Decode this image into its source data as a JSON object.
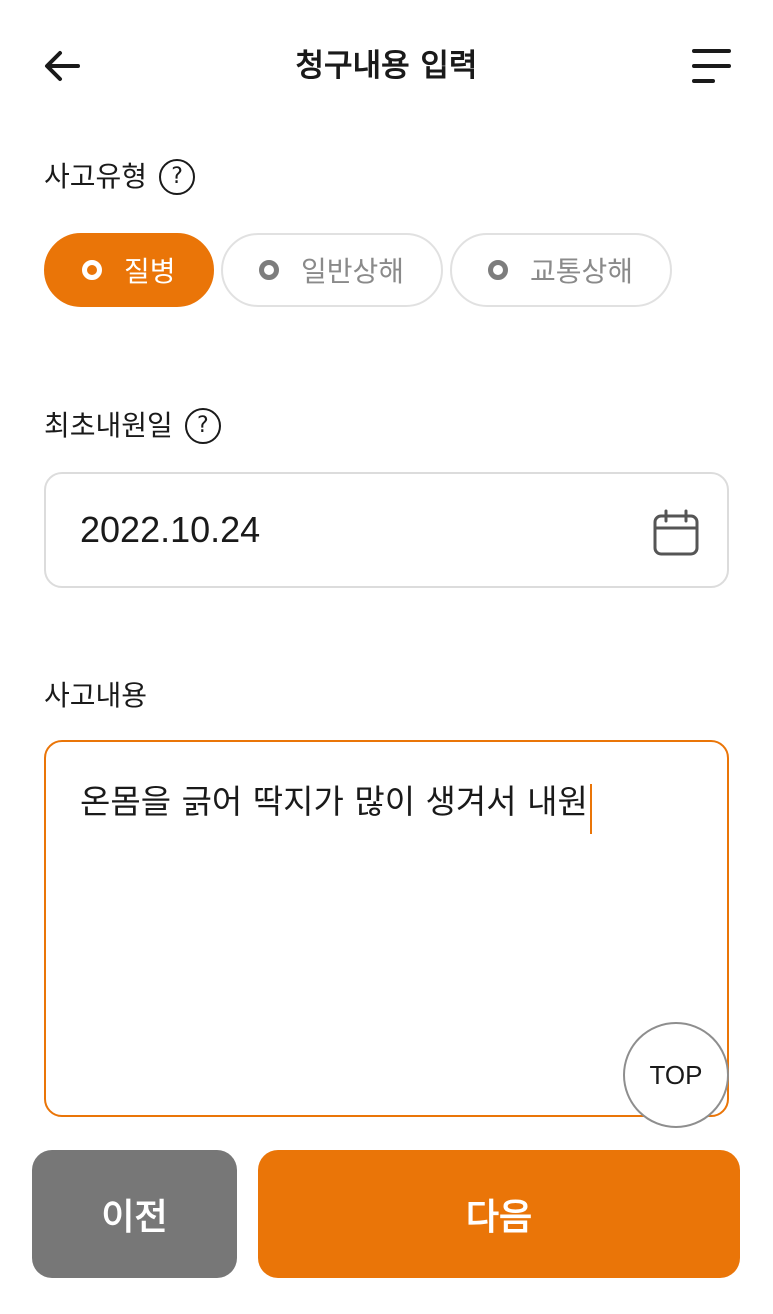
{
  "header": {
    "title": "청구내용 입력",
    "back_icon": "arrow-left-icon",
    "menu_icon": "menu-icon"
  },
  "accident_type": {
    "label": "사고유형",
    "help": "?",
    "options": [
      {
        "label": "질병",
        "selected": true
      },
      {
        "label": "일반상해",
        "selected": false
      },
      {
        "label": "교통상해",
        "selected": false
      }
    ]
  },
  "first_visit": {
    "label": "최초내원일",
    "help": "?",
    "value": "2022.10.24",
    "icon": "calendar-icon"
  },
  "accident_detail": {
    "label": "사고내용",
    "value": "온몸을 긁어 딱지가 많이 생겨서 내원"
  },
  "top_button": "TOP",
  "footer": {
    "prev_label": "이전",
    "next_label": "다음"
  },
  "colors": {
    "accent": "#ea7508",
    "secondary_button": "#777777"
  }
}
